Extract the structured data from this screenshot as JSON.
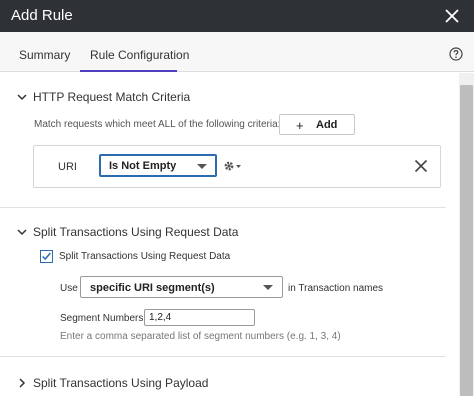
{
  "dialog": {
    "title": "Add Rule"
  },
  "tabs": [
    {
      "label": "Summary",
      "active": false
    },
    {
      "label": "Rule Configuration",
      "active": true
    }
  ],
  "http_match": {
    "heading": "HTTP Request Match Criteria",
    "hint": "Match requests which meet ALL of the following criteria:",
    "add_label": "Add",
    "add_glyph": "+",
    "criteria": {
      "field": "URI",
      "operator": "Is Not Empty"
    }
  },
  "split_request": {
    "heading": "Split Transactions Using Request Data",
    "checkbox_label": "Split Transactions Using Request Data",
    "checked": true,
    "use_label": "Use",
    "use_value": "specific URI segment(s)",
    "use_suffix": "in Transaction names",
    "segment_label": "Segment Numbers",
    "segment_value": "1,2,4",
    "segment_hint": "Enter a comma separated list of segment numbers (e.g. 1, 3, 4)"
  },
  "split_payload": {
    "heading": "Split Transactions Using Payload"
  },
  "colors": {
    "titlebar": "#2e3236",
    "tab_accent": "#4f3fbf",
    "focus": "#2b6cb0"
  }
}
